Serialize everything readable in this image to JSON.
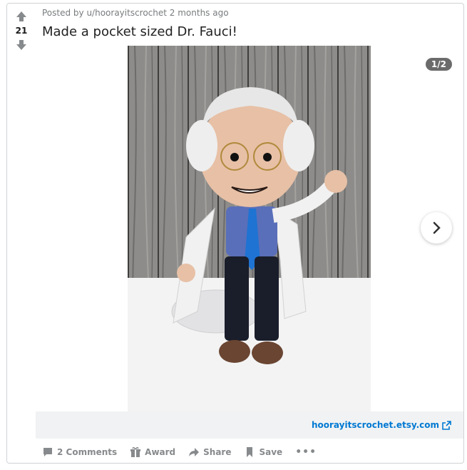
{
  "post": {
    "score": "21",
    "meta": "Posted by u/hoorayitscrochet 2 months ago",
    "title": "Made a pocket sized Dr. Fauci!"
  },
  "gallery": {
    "counter": "1/2",
    "image_description": "Crocheted doll of a white-haired man in glasses, white coat, blue shirt and tie"
  },
  "link": {
    "text": "hoorayitscrochet.etsy.com"
  },
  "actions": {
    "comments": "2 Comments",
    "award": "Award",
    "share": "Share",
    "save": "Save",
    "more": "•••"
  },
  "colors": {
    "accent": "#0079d3",
    "muted": "#878a8c",
    "link_bar_bg": "#f1f2f3"
  }
}
